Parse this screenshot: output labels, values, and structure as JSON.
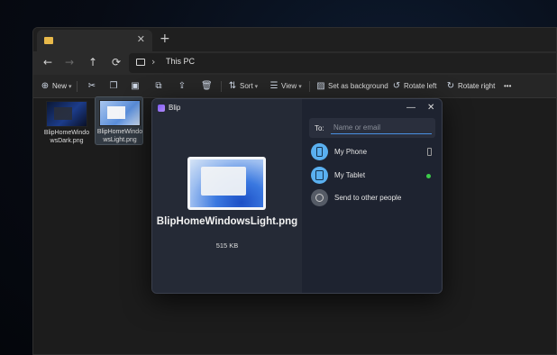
{
  "explorer": {
    "tab": {
      "close": "✕"
    },
    "new_tab": "+",
    "nav": {
      "back": "←",
      "forward": "→",
      "up": "↑",
      "refresh": "⟳"
    },
    "address": {
      "separator": "›",
      "location": "This PC"
    },
    "toolbar": {
      "new_label": "New",
      "sort_label": "Sort",
      "view_label": "View",
      "set_background_label": "Set as background",
      "rotate_left_label": "Rotate left",
      "rotate_right_label": "Rotate right",
      "more_label": "•••"
    },
    "files": [
      {
        "name": "BlipHomeWindowsDark.png",
        "selected": false
      },
      {
        "name": "BlipHomeWindowsLight.png",
        "selected": true
      }
    ]
  },
  "blip": {
    "title": "Blip",
    "minimize": "—",
    "close": "✕",
    "file_name": "BlipHomeWindowsLight.png",
    "file_size": "515 KB",
    "to_label": "To:",
    "to_placeholder": "Name or email",
    "to_value": "",
    "devices": [
      {
        "label": "My Phone",
        "icon": "phone-icon",
        "status": "phone-status-icon"
      },
      {
        "label": "My Tablet",
        "icon": "tablet-icon",
        "status": "online"
      },
      {
        "label": "Send to other people",
        "icon": "people-icon",
        "status": ""
      }
    ]
  },
  "colors": {
    "accent": "#4a90e2",
    "device_icon": "#5ab0f0",
    "online": "#3ccc4a",
    "blip_logo": "#7d5cf5",
    "folder": "#e8b94a"
  }
}
